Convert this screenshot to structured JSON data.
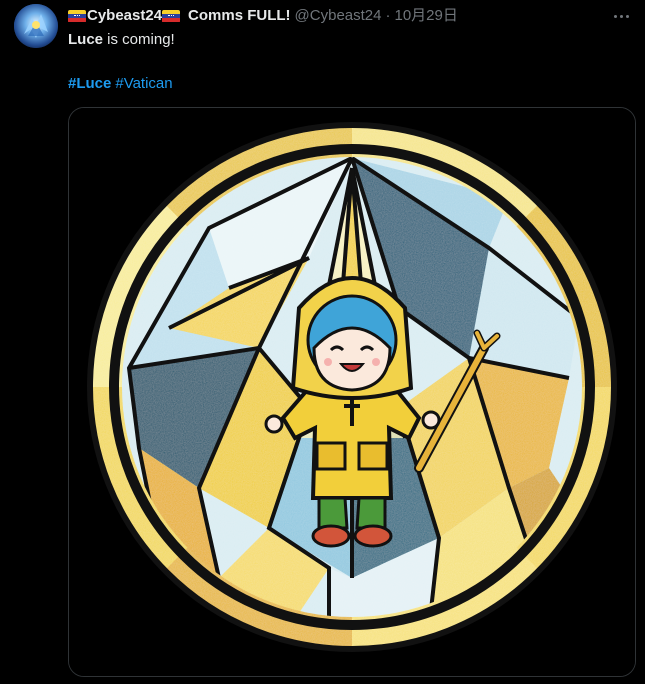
{
  "tweet": {
    "display_name": "Cybeast24",
    "display_name_suffix": "Comms FULL!",
    "handle": "@Cybeast24",
    "separator": "·",
    "date": "10月29日",
    "text_bold": "Luce",
    "text_rest": " is coming!",
    "hashtags": [
      "#Luce",
      "#Vatican"
    ]
  },
  "icons": {
    "avatar": "avatar-image",
    "flag": "venezuela-flag-icon",
    "more": "more-options-icon"
  },
  "colors": {
    "background": "#000000",
    "text": "#e7e9ea",
    "secondary_text": "#71767b",
    "link": "#1d9bf0",
    "border": "#2f3336"
  }
}
